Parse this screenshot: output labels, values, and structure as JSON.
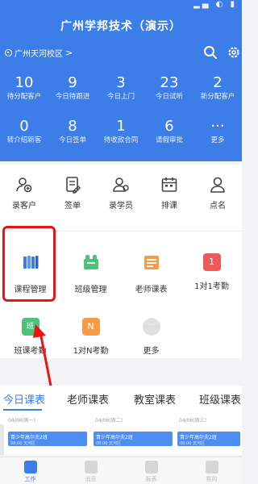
{
  "status_bar": {
    "icons": "▂▄ ◐ ▮"
  },
  "header": {
    "title": "广州学邦技术（演示）",
    "campus": "广州天河校区",
    "campus_chevron": ">"
  },
  "stats": [
    [
      {
        "value": "10",
        "label": "待分配客户"
      },
      {
        "value": "9",
        "label": "今日待跟进"
      },
      {
        "value": "3",
        "label": "今日上门"
      },
      {
        "value": "23",
        "label": "今日试听"
      },
      {
        "value": "2",
        "label": "新分配客户"
      }
    ],
    [
      {
        "value": "0",
        "label": "转介绍新客"
      },
      {
        "value": "8",
        "label": "今日签单"
      },
      {
        "value": "1",
        "label": "待收款合同"
      },
      {
        "value": "6",
        "label": "请假审批"
      },
      {
        "value": "···",
        "label": "更多"
      }
    ]
  ],
  "quick_actions": [
    {
      "label": "录客户",
      "icon": "add-customer-icon"
    },
    {
      "label": "签单",
      "icon": "contract-icon"
    },
    {
      "label": "录学员",
      "icon": "add-student-icon"
    },
    {
      "label": "排课",
      "icon": "schedule-icon"
    },
    {
      "label": "点名",
      "icon": "roll-call-icon"
    }
  ],
  "apps": [
    [
      {
        "label": "课程管理",
        "icon": "course-books-icon",
        "color": "#3d7de8"
      },
      {
        "label": "班级管理",
        "icon": "class-management-icon",
        "color": "#4cc27a"
      },
      {
        "label": "老师课表",
        "icon": "teacher-schedule-icon",
        "color": "#f59a45"
      },
      {
        "label": "1对1考勤",
        "icon": "one-to-one-icon",
        "color": "#ee5a5a",
        "badge": "1"
      }
    ],
    [
      {
        "label": "班课考勤",
        "icon": "class-attendance-icon",
        "color": "#4cc27a",
        "badge": "班"
      },
      {
        "label": "1对N考勤",
        "icon": "one-to-n-icon",
        "color": "#f59a45",
        "badge": "N"
      },
      {
        "label": "更多",
        "icon": "more-apps-icon",
        "color": "#e0e0e0",
        "badge": "···"
      }
    ]
  ],
  "tabs": [
    "今日课表",
    "老师课表",
    "教室课表",
    "班级课表"
  ],
  "schedule": {
    "days": [
      "04/06(周一)",
      "04/06(周二)",
      "04/06(周三)"
    ],
    "events": [
      {
        "title": "青少年高尔夫2班",
        "sub": "08:00 天河区"
      },
      {
        "title": "青少年高尔夫2班",
        "sub": "08:00 天河区"
      },
      {
        "title": "青少年高尔夫2班",
        "sub": "08:00 天河区"
      }
    ]
  },
  "bottom_nav": [
    "工作",
    "消息",
    "报表",
    "我的"
  ],
  "colors": {
    "primary": "#3d7de8",
    "highlight": "#ee1111"
  }
}
